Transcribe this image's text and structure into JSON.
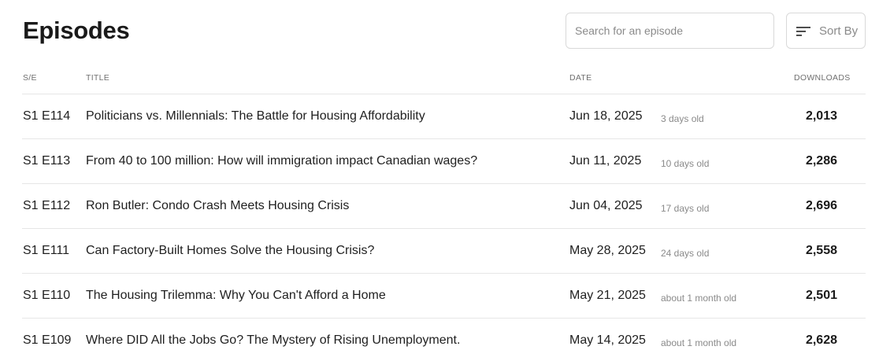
{
  "header": {
    "title": "Episodes",
    "search_placeholder": "Search for an episode",
    "sort_label": "Sort By"
  },
  "columns": {
    "se": "S/E",
    "title": "TITLE",
    "date": "DATE",
    "downloads": "DOWNLOADS"
  },
  "episodes": [
    {
      "se": "S1 E114",
      "title": "Politicians vs. Millennials: The Battle for Housing Affordability",
      "date": "Jun 18, 2025",
      "age": "3 days old",
      "downloads": "2,013"
    },
    {
      "se": "S1 E113",
      "title": "From 40 to 100 million: How will immigration impact Canadian wages?",
      "date": "Jun 11, 2025",
      "age": "10 days old",
      "downloads": "2,286"
    },
    {
      "se": "S1 E112",
      "title": "Ron Butler: Condo Crash Meets Housing Crisis",
      "date": "Jun 04, 2025",
      "age": "17 days old",
      "downloads": "2,696"
    },
    {
      "se": "S1 E111",
      "title": "Can Factory-Built Homes Solve the Housing Crisis?",
      "date": "May 28, 2025",
      "age": "24 days old",
      "downloads": "2,558"
    },
    {
      "se": "S1 E110",
      "title": "The Housing Trilemma: Why You Can't Afford a Home",
      "date": "May 21, 2025",
      "age": "about 1 month old",
      "downloads": "2,501"
    },
    {
      "se": "S1 E109",
      "title": "Where DID All the Jobs Go? The Mystery of Rising Unemployment.",
      "date": "May 14, 2025",
      "age": "about 1 month old",
      "downloads": "2,628"
    }
  ]
}
